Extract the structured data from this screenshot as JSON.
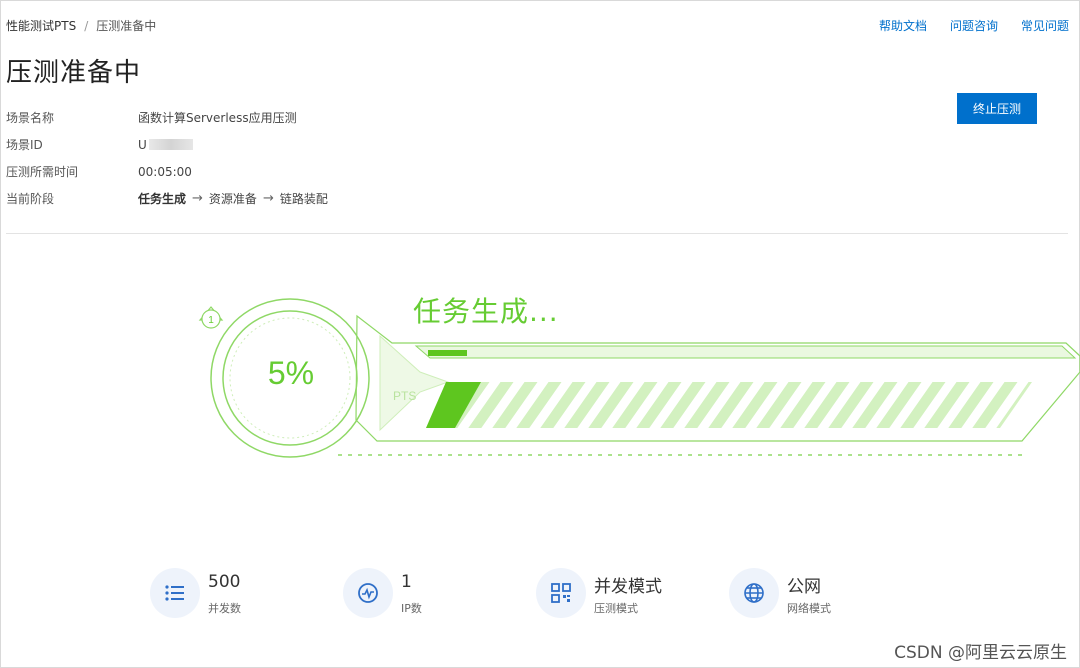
{
  "breadcrumb": {
    "root": "性能测试PTS",
    "separator": "/",
    "current": "压测准备中"
  },
  "header_links": [
    "帮助文档",
    "问题咨询",
    "常见问题"
  ],
  "page_title": "压测准备中",
  "stop_button": "终止压测",
  "info": {
    "scene_name_label": "场景名称",
    "scene_name_value": "函数计算Serverless应用压测",
    "scene_id_label": "场景ID",
    "scene_id_value": "U",
    "duration_label": "压测所需时间",
    "duration_value": "00:05:00",
    "stage_label": "当前阶段",
    "stages": [
      "任务生成",
      "资源准备",
      "链路装配"
    ],
    "stage_arrow": "→"
  },
  "progress": {
    "percent_text": "5%",
    "percent": 5,
    "stage_title": "任务生成...",
    "step_badge": "1",
    "pts_label": "PTS"
  },
  "stats": [
    {
      "value": "500",
      "label": "并发数",
      "icon": "list-icon"
    },
    {
      "value": "1",
      "label": "IP数",
      "icon": "monitor-chart-icon"
    },
    {
      "value": "并发模式",
      "label": "压测模式",
      "icon": "grid-icon"
    },
    {
      "value": "公网",
      "label": "网络模式",
      "icon": "globe-icon"
    }
  ],
  "colors": {
    "accent": "#0070cc",
    "green": "#66cc33",
    "light_green": "#c9efb4"
  },
  "watermark": "CSDN @阿里云云原生"
}
